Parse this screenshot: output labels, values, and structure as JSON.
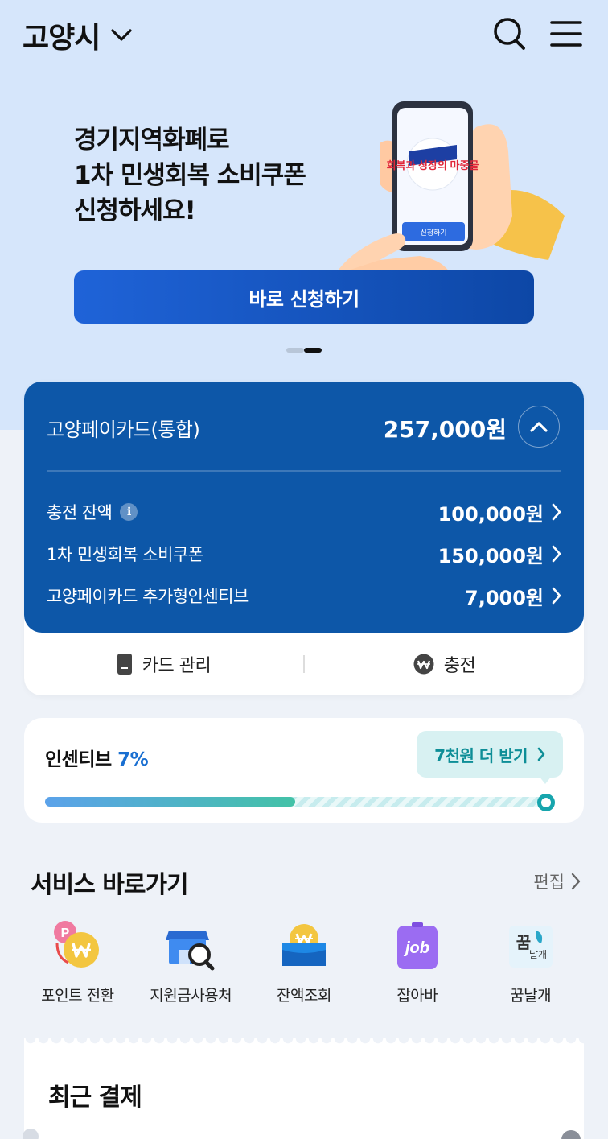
{
  "header": {
    "city": "고양시",
    "icons": [
      "chevron-down-icon",
      "search-icon",
      "menu-icon"
    ]
  },
  "banner": {
    "line1": "경기지역화폐로",
    "line2": "1차 민생회복 소비쿠폰",
    "line3": "신청하세요!",
    "phone_screen_button": "신청하기",
    "phone_screen_logo": "회복과 성장의 마중물",
    "cta": "바로 신청하기",
    "slide_count": 2,
    "active_slide": 2
  },
  "card": {
    "name": "고양페이카드(통합)",
    "total": "257,000원",
    "rows": [
      {
        "label": "충전 잔액",
        "value": "100,000원",
        "info": "i"
      },
      {
        "label": "1차 민생회복 소비쿠폰",
        "value": "150,000원"
      },
      {
        "label": "고양페이카드 추가형인센티브",
        "value": "7,000원"
      }
    ],
    "actions": {
      "manage": "카드 관리",
      "charge": "충전"
    }
  },
  "incentive": {
    "title": "인센티브",
    "percent": "7%",
    "bubble": "7천원 더 받기",
    "progress_fraction": 0.5
  },
  "services": {
    "title": "서비스 바로가기",
    "edit": "편집",
    "items": [
      {
        "label": "포인트 전환",
        "icon": "point-convert-icon"
      },
      {
        "label": "지원금사용처",
        "icon": "store-search-icon"
      },
      {
        "label": "잔액조회",
        "icon": "wallet-balance-icon"
      },
      {
        "label": "잡아바",
        "icon": "job-icon",
        "icon_text": "job"
      },
      {
        "label": "꿈날개",
        "icon": "dream-wings-icon",
        "icon_text_1": "꿈",
        "icon_text_2": "날개"
      }
    ]
  },
  "recent": {
    "title": "최근 결제"
  },
  "colors": {
    "hero_bg": "#d6e6fb",
    "card_blue": "#0d57a8",
    "cta": "#1f63d8",
    "accent_teal": "#17a5ad"
  }
}
